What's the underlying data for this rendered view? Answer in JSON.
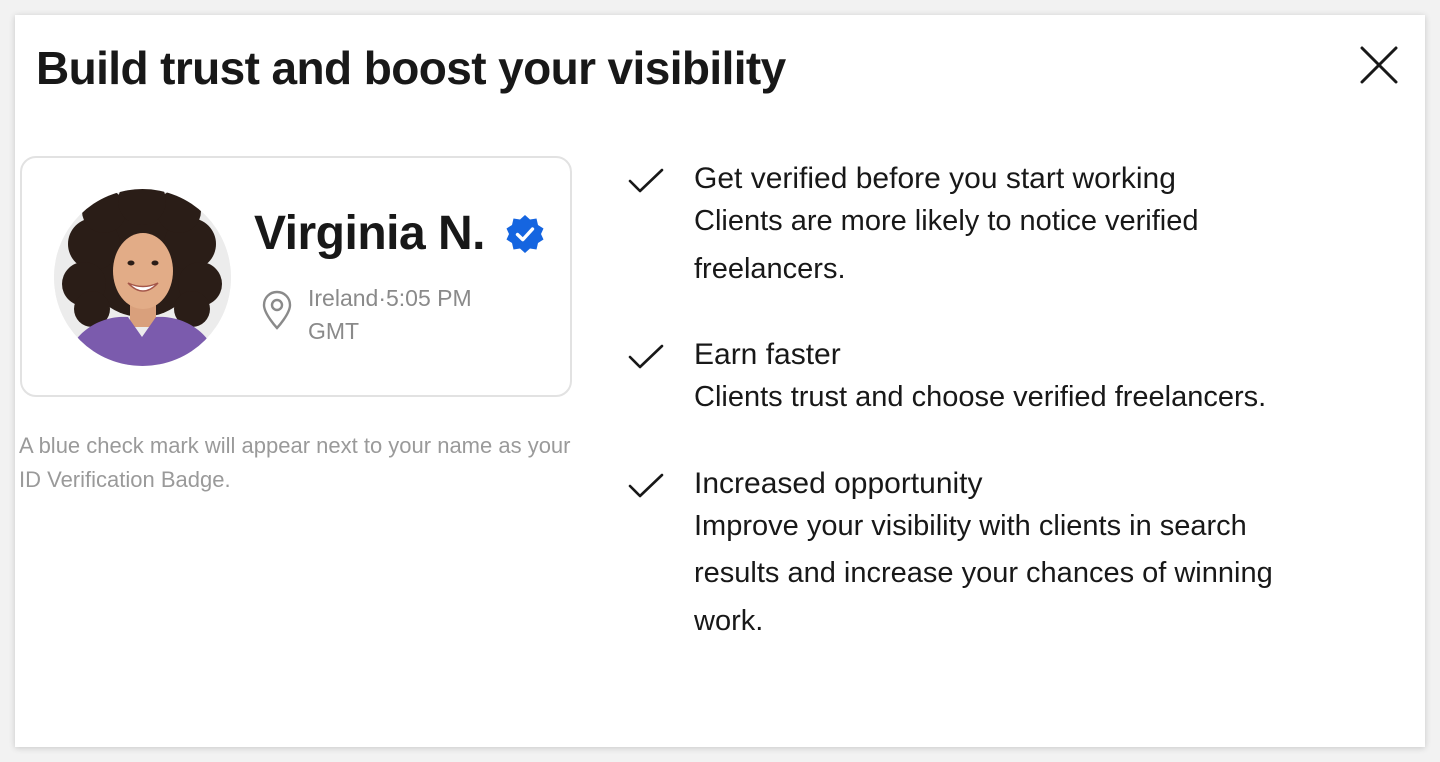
{
  "modal": {
    "title": "Build trust and boost your visibility",
    "close_icon": "close-icon"
  },
  "profile_card": {
    "name": "Virginia N.",
    "verified_badge_icon": "verified-badge-icon",
    "verified_badge_color": "#1565e0",
    "location_icon": "location-pin-icon",
    "location": "Ireland·5:05 PM GMT"
  },
  "caption": "A blue check mark will appear next to your name as your ID Verification Badge.",
  "benefits": [
    {
      "icon": "checkmark-icon",
      "title": "Get verified before you start working",
      "description": "Clients are more likely to notice verified freelancers."
    },
    {
      "icon": "checkmark-icon",
      "title": "Earn faster",
      "description": "Clients trust and choose verified freelancers."
    },
    {
      "icon": "checkmark-icon",
      "title": "Increased opportunity",
      "description": "Improve your visibility with clients in search results and increase your chances of winning work."
    }
  ]
}
